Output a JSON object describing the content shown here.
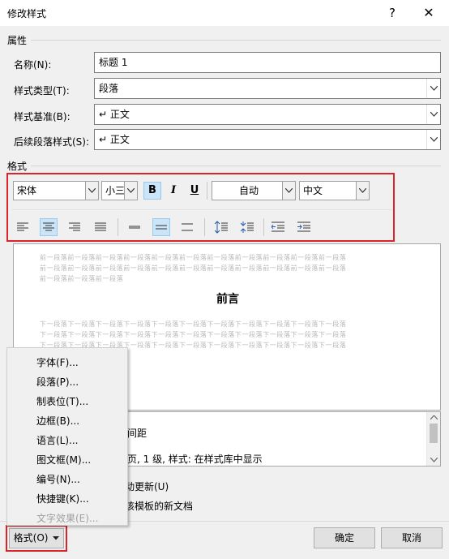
{
  "window": {
    "title": "修改样式",
    "help": "?",
    "close": "✕"
  },
  "properties": {
    "section_label": "属性",
    "name_label": "名称(N):",
    "name_value": "标题 1",
    "type_label": "样式类型(T):",
    "type_value": "段落",
    "based_on_label": "样式基准(B):",
    "based_on_value": "↵ 正文",
    "following_label": "后续段落样式(S):",
    "following_value": "↵ 正文"
  },
  "format": {
    "section_label": "格式",
    "font": "宋体",
    "size": "小三",
    "bold": "B",
    "italic": "I",
    "underline": "U",
    "color": "自动",
    "script": "中文",
    "bold_on": true
  },
  "preview": {
    "prev_paragraph_line": "前一段落前一段落前一段落前一段落前一段落前一段落前一段落前一段落前一段落前一段落前一段落",
    "prev_paragraph_last": "前一段落前一段落前一段落",
    "heading": "前言",
    "next_paragraph_line": "下一段落下一段落下一段落下一段落下一段落下一段落下一段落下一段落下一段落下一段落下一段落"
  },
  "description": {
    "line1": "间距",
    "line2": "页, 1 级, 样式: 在样式库中显示"
  },
  "options": {
    "auto_update": "动更新(U)",
    "new_docs": "该模板的新文档"
  },
  "format_menu": {
    "items": [
      {
        "label": "字体(F)..."
      },
      {
        "label": "段落(P)..."
      },
      {
        "label": "制表位(T)..."
      },
      {
        "label": "边框(B)..."
      },
      {
        "label": "语言(L)..."
      },
      {
        "label": "图文框(M)..."
      },
      {
        "label": "编号(N)..."
      },
      {
        "label": "快捷键(K)..."
      },
      {
        "label": "文字效果(E)..."
      }
    ]
  },
  "buttons": {
    "format": "格式(O)",
    "ok": "确定",
    "cancel": "取消"
  },
  "colors": {
    "highlight_red": "#d9242b",
    "toggle_on": "#cce4f7"
  }
}
